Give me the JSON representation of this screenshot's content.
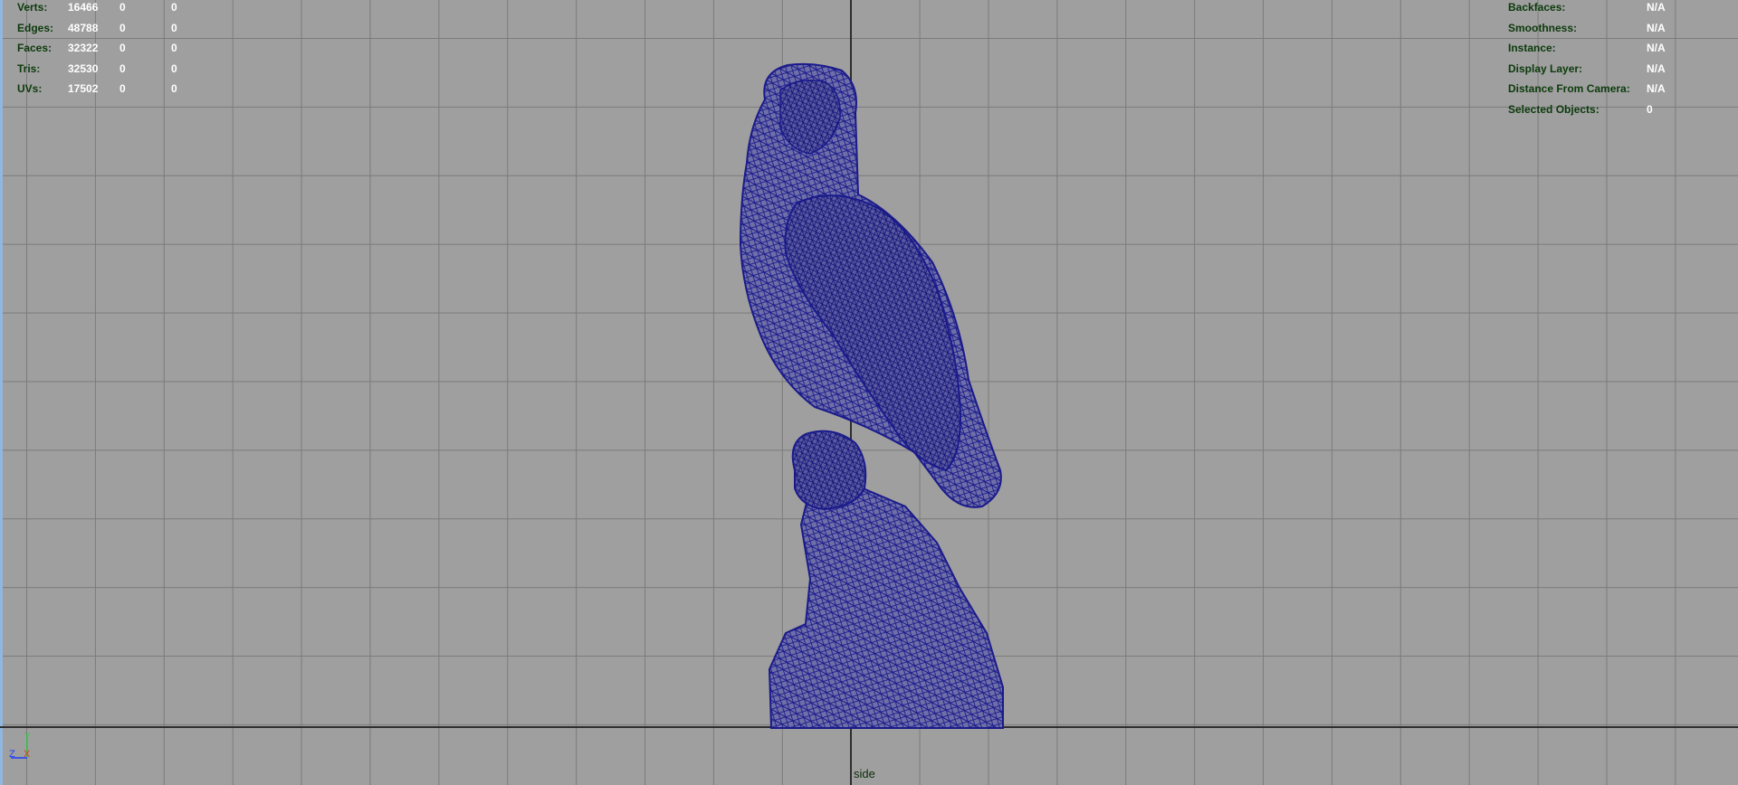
{
  "viewport": {
    "camera_label": "side"
  },
  "hud_left": {
    "rows": [
      {
        "label": "Verts:",
        "v1": "16466",
        "v2": "0",
        "v3": "0"
      },
      {
        "label": "Edges:",
        "v1": "48788",
        "v2": "0",
        "v3": "0"
      },
      {
        "label": "Faces:",
        "v1": "32322",
        "v2": "0",
        "v3": "0"
      },
      {
        "label": "Tris:",
        "v1": "32530",
        "v2": "0",
        "v3": "0"
      },
      {
        "label": "UVs:",
        "v1": "17502",
        "v2": "0",
        "v3": "0"
      }
    ]
  },
  "hud_right": {
    "rows": [
      {
        "label": "Backfaces:",
        "value": "N/A"
      },
      {
        "label": "Smoothness:",
        "value": "N/A"
      },
      {
        "label": "Instance:",
        "value": "N/A"
      },
      {
        "label": "Display Layer:",
        "value": "N/A"
      },
      {
        "label": "Distance From Camera:",
        "value": "N/A"
      },
      {
        "label": "Selected Objects:",
        "value": "0"
      }
    ]
  },
  "axis_gizmo": {
    "y_label": "Y",
    "z_label": "Z",
    "x_label": "X",
    "y_color": "#2ecc40",
    "z_color": "#1f3fff",
    "x_color": "#e03a1e"
  },
  "colors": {
    "background": "#9f9f9f",
    "grid": "#7b7b7b",
    "axis": "#2e2e2e",
    "wireframe": "#1a1a8c",
    "hud_label": "#0c3a0c",
    "hud_value": "#ffffff"
  }
}
